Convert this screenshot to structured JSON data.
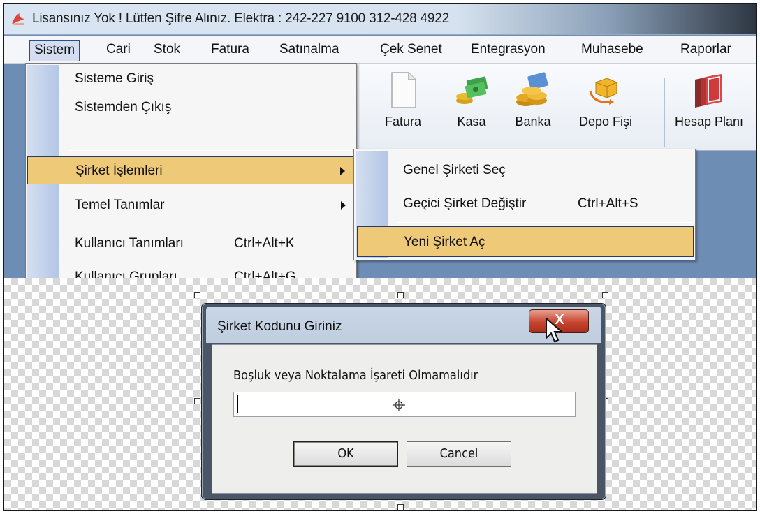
{
  "window": {
    "title": "Lisansınız Yok ! Lütfen Şifre Alınız. Elektra : 242-227 9100    312-428 4922"
  },
  "menubar": {
    "items": [
      {
        "label": "Sistem"
      },
      {
        "label": "Cari"
      },
      {
        "label": "Stok"
      },
      {
        "label": "Fatura"
      },
      {
        "label": "Satınalma"
      },
      {
        "label": "Çek Senet"
      },
      {
        "label": "Entegrasyon"
      },
      {
        "label": "Muhasebe"
      },
      {
        "label": "Raporlar"
      }
    ]
  },
  "toolbar": {
    "buttons": [
      {
        "label": "Fatura",
        "icon": "document-icon"
      },
      {
        "label": "Kasa",
        "icon": "money-icon"
      },
      {
        "label": "Banka",
        "icon": "coins-icon"
      },
      {
        "label": "Depo Fişi",
        "icon": "boxes-icon"
      },
      {
        "label": "Hesap Planı",
        "icon": "books-icon"
      }
    ]
  },
  "sistem_menu": {
    "items": [
      {
        "label": "Sisteme Giriş",
        "shortcut": ""
      },
      {
        "label": "Sistemden Çıkış",
        "shortcut": ""
      },
      {
        "label": "Şirket İşlemleri",
        "shortcut": "",
        "submenu": true,
        "highlighted": true
      },
      {
        "label": "Temel Tanımlar",
        "shortcut": "",
        "submenu": true
      },
      {
        "label": "Kullanıcı Tanımları",
        "shortcut": "Ctrl+Alt+K"
      },
      {
        "label": "Kullanıcı Grupları",
        "shortcut": "Ctrl+Alt+G"
      }
    ]
  },
  "sirket_submenu": {
    "items": [
      {
        "label": "Genel Şirketi Seç",
        "shortcut": ""
      },
      {
        "label": "Geçici Şirket Değiştir",
        "shortcut": "Ctrl+Alt+S"
      },
      {
        "label": "Yeni Şirket Aç",
        "shortcut": "",
        "highlighted": true
      }
    ]
  },
  "dialog": {
    "title": "Şirket Kodunu Giriniz",
    "close_label": "X",
    "prompt": "Boşluk veya Noktalama İşareti Olmamalıdır",
    "input_value": "",
    "ok_label": "OK",
    "cancel_label": "Cancel"
  },
  "colors": {
    "highlight": "#eec977",
    "highlight_border": "#1c3d73",
    "app_background": "#6e8db4",
    "close_button": "#c7442f"
  }
}
